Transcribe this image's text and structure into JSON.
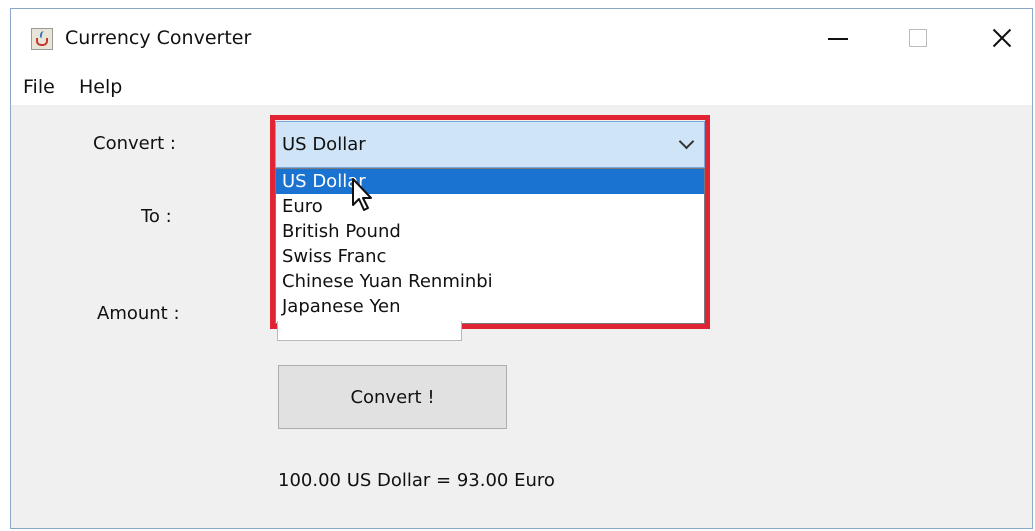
{
  "window": {
    "title": "Currency Converter",
    "icon": "java-cup-icon"
  },
  "menu": {
    "file": "File",
    "help": "Help"
  },
  "form": {
    "convert_label": "Convert :",
    "to_label": "To :",
    "amount_label": "Amount :",
    "from_selected": "US Dollar",
    "dropdown_options": [
      "US Dollar",
      "Euro",
      "British Pound",
      "Swiss Franc",
      "Chinese Yuan Renminbi",
      "Japanese Yen"
    ],
    "convert_button": "Convert !",
    "result_text": "100.00 US Dollar = 93.00 Euro"
  },
  "colors": {
    "highlight_border": "#e02433",
    "selected_option": "#1a73d1",
    "combo_background": "#cfe4f7"
  }
}
